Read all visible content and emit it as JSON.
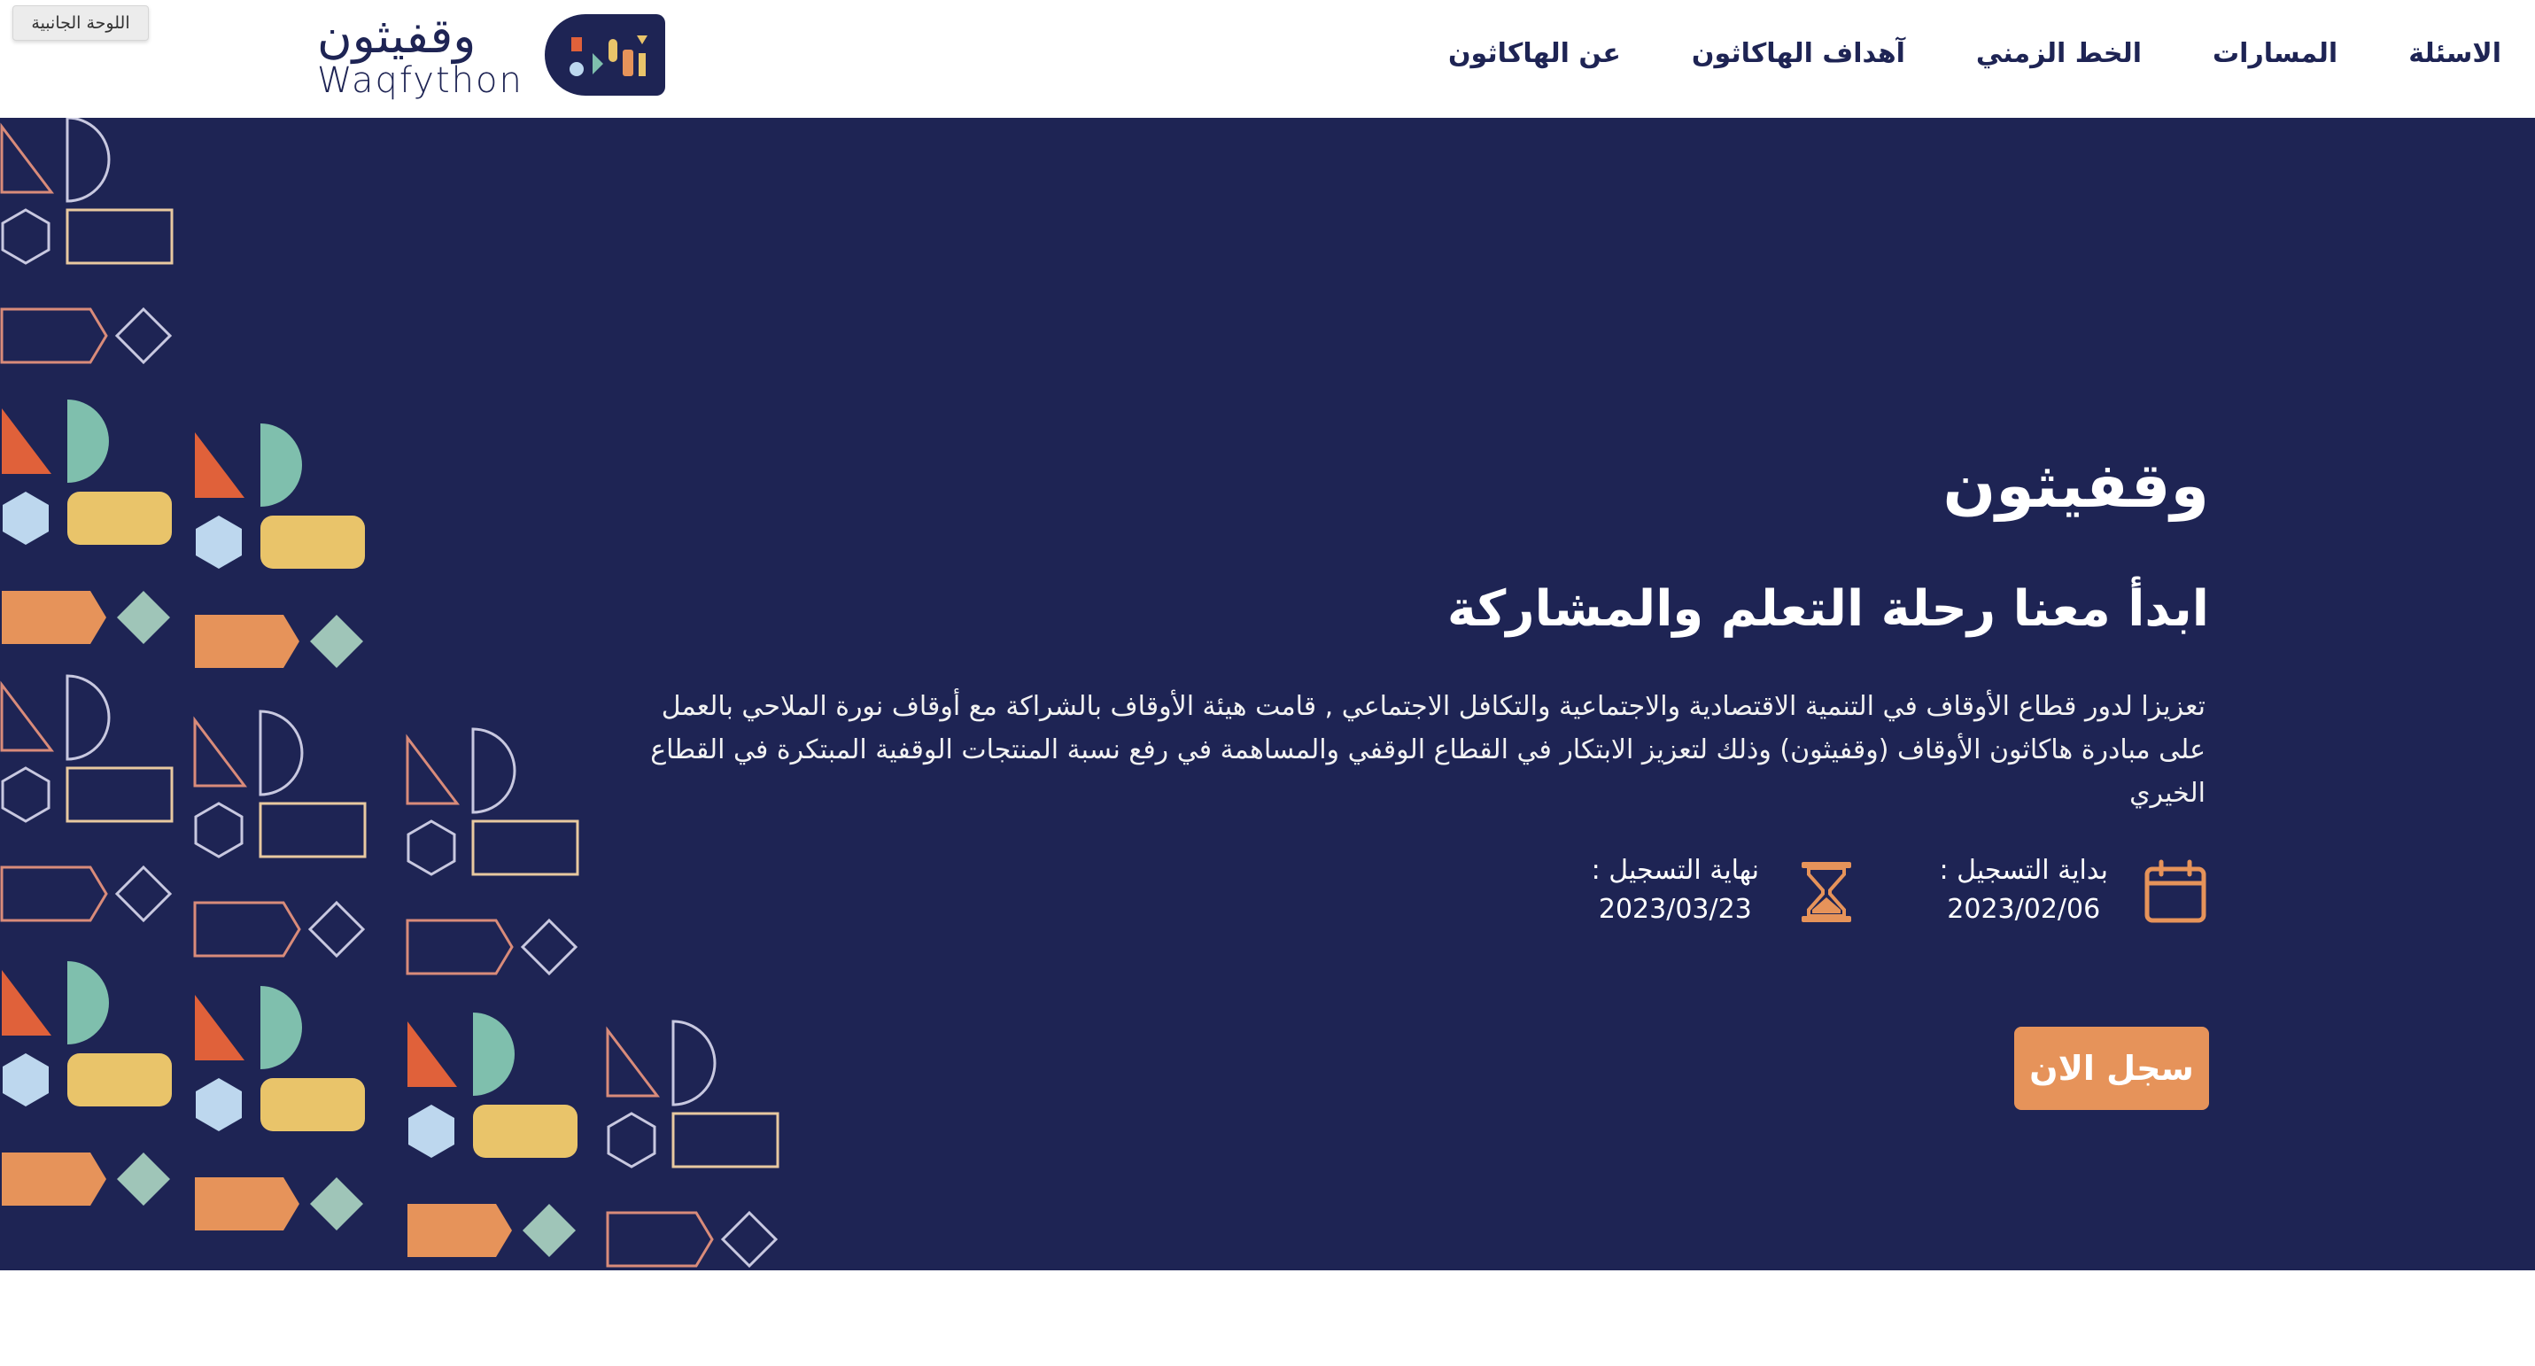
{
  "sidebar_button": {
    "label": "اللوحة الجانبية"
  },
  "logo": {
    "arabic": "وقفيثون",
    "english": "Waqfython",
    "icon": "waqfython-logo-mark"
  },
  "nav": {
    "items": [
      {
        "label": "عن الهاكاثون"
      },
      {
        "label": "آهداف الهاكاثون"
      },
      {
        "label": "الخط الزمني"
      },
      {
        "label": "المسارات"
      },
      {
        "label": "الاسئلة"
      }
    ]
  },
  "hero": {
    "title": "وقفيثون",
    "subtitle": "ابدأ معنا رحلة التعلم والمشاركة",
    "description": "تعزيزا لدور قطاع الأوقاف في التنمية الاقتصادية والاجتماعية والتكافل الاجتماعي , قامت هيئة الأوقاف بالشراكة مع أوقاف نورة الملاحي بالعمل على مبادرة هاكاثون الأوقاف (وقفيثون) وذلك لتعزيز الابتكار في القطاع الوقفي والمساهمة في رفع نسبة المنتجات الوقفية المبتكرة في القطاع الخيري",
    "registration_start": {
      "label": "بداية التسجيل :",
      "date": "2023/02/06",
      "icon": "calendar-icon"
    },
    "registration_end": {
      "label": "نهاية التسجيل :",
      "date": "2023/03/23",
      "icon": "hourglass-icon"
    },
    "register_button": "سجل الان"
  },
  "colors": {
    "navy": "#1e2454",
    "orange": "#e6935a",
    "red_orange": "#e0613a",
    "yellow": "#e9c46a",
    "teal": "#7fbfad",
    "light_blue": "#bdd7ee",
    "sage": "#9fc5b8",
    "outline_pink": "#d98b7a",
    "outline_sand": "#e8c9a0",
    "outline_lav": "#c8c8e0"
  }
}
